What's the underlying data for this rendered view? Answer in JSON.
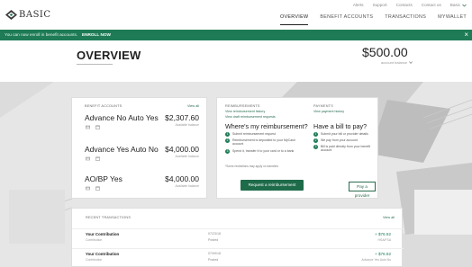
{
  "header": {
    "logo_text": "BASIC",
    "utility": [
      "Alerts",
      "Support",
      "Contacts",
      "Contact us"
    ],
    "user_menu": "Basic",
    "nav": [
      {
        "label": "OVERVIEW",
        "active": true
      },
      {
        "label": "BENEFIT ACCOUNTS",
        "active": false
      },
      {
        "label": "TRANSACTIONS",
        "active": false
      },
      {
        "label": "MYWALLET",
        "active": false
      }
    ]
  },
  "banner": {
    "message": "You can now enroll in benefit accounts.",
    "action": "ENROLL NOW",
    "close_icon": "close-icon"
  },
  "overview": {
    "title": "OVERVIEW",
    "balance": "$500.00",
    "balance_label": "account balance"
  },
  "benefit_accounts": {
    "heading": "BENEFIT ACCOUNTS",
    "view_all": "View all",
    "accounts": [
      {
        "name": "Advance No Auto Yes",
        "amount": "$2,307.60",
        "sub": "Available balance"
      },
      {
        "name": "Advance Yes Auto No",
        "amount": "$4,000.00",
        "sub": "Available balance"
      },
      {
        "name": "AO/BP Yes",
        "amount": "$4,000.00",
        "sub": "Available balance"
      }
    ]
  },
  "reimbursements": {
    "heading": "REIMBURSEMENTS",
    "link1": "View reimbursement history",
    "link2": "View draft reimbursement requests",
    "question": "Where's my reimbursement?",
    "steps": [
      "Submit reimbursement request",
      "Reimbursement is deposited to your MyCash account",
      "Spend it, transfer it to your card or to a bank"
    ],
    "note": "*Some restrictions may apply on transfers",
    "button": "Request a reimbursement"
  },
  "payments": {
    "heading": "PAYMENTS",
    "link": "View payment history",
    "question": "Have a bill to pay?",
    "steps": [
      "Submit your bill or provider details",
      "We pay from your account",
      "Bill is paid directly from your benefit account"
    ],
    "button": "Pay a provider"
  },
  "transactions": {
    "heading": "RECENT TRANSACTIONS",
    "view_all": "View all",
    "rows": [
      {
        "title": "Your Contribution",
        "sub": "Contribution",
        "date": "07/23/18",
        "status": "Posted",
        "amount": "+ $76.92",
        "amount_sub": "HSA/FSA"
      },
      {
        "title": "Your Contribution",
        "sub": "Contribution",
        "date": "07/09/18",
        "status": "Posted",
        "amount": "+ $76.92",
        "amount_sub": "Advance Yes Auto No"
      }
    ]
  }
}
